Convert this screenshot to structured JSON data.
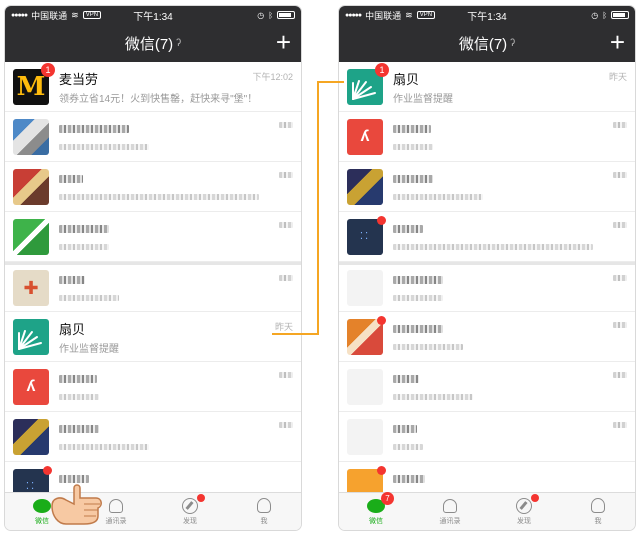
{
  "status_bar": {
    "carrier": "中国联通",
    "vpn": "VPN",
    "time": "下午1:34",
    "wifi_icon": "wifi-icon"
  },
  "nav": {
    "title": "微信(7)",
    "ear_icon": "ear-icon",
    "plus_icon": "plus-icon"
  },
  "left_chats": {
    "mcd": {
      "name": "麦当劳",
      "preview": "领券立省14元！火到快售罄，赶快来寻\"堡\"！",
      "time": "下午12:02",
      "badge": "1"
    },
    "shanbay": {
      "name": "扇贝",
      "preview": "作业监督提醒",
      "time": "昨天"
    }
  },
  "right_chats": {
    "shanbay": {
      "name": "扇贝",
      "preview": "作业监督提醒",
      "time": "昨天",
      "badge": "1"
    }
  },
  "tabbar": {
    "wechat": "微信",
    "contacts": "通讯录",
    "discover": "发现",
    "me": "我",
    "right_badge": "7"
  },
  "colors": {
    "header": "#2e2e30",
    "active_green": "#1aad19",
    "badge_red": "#f43530",
    "connector_orange": "#f5a623"
  }
}
